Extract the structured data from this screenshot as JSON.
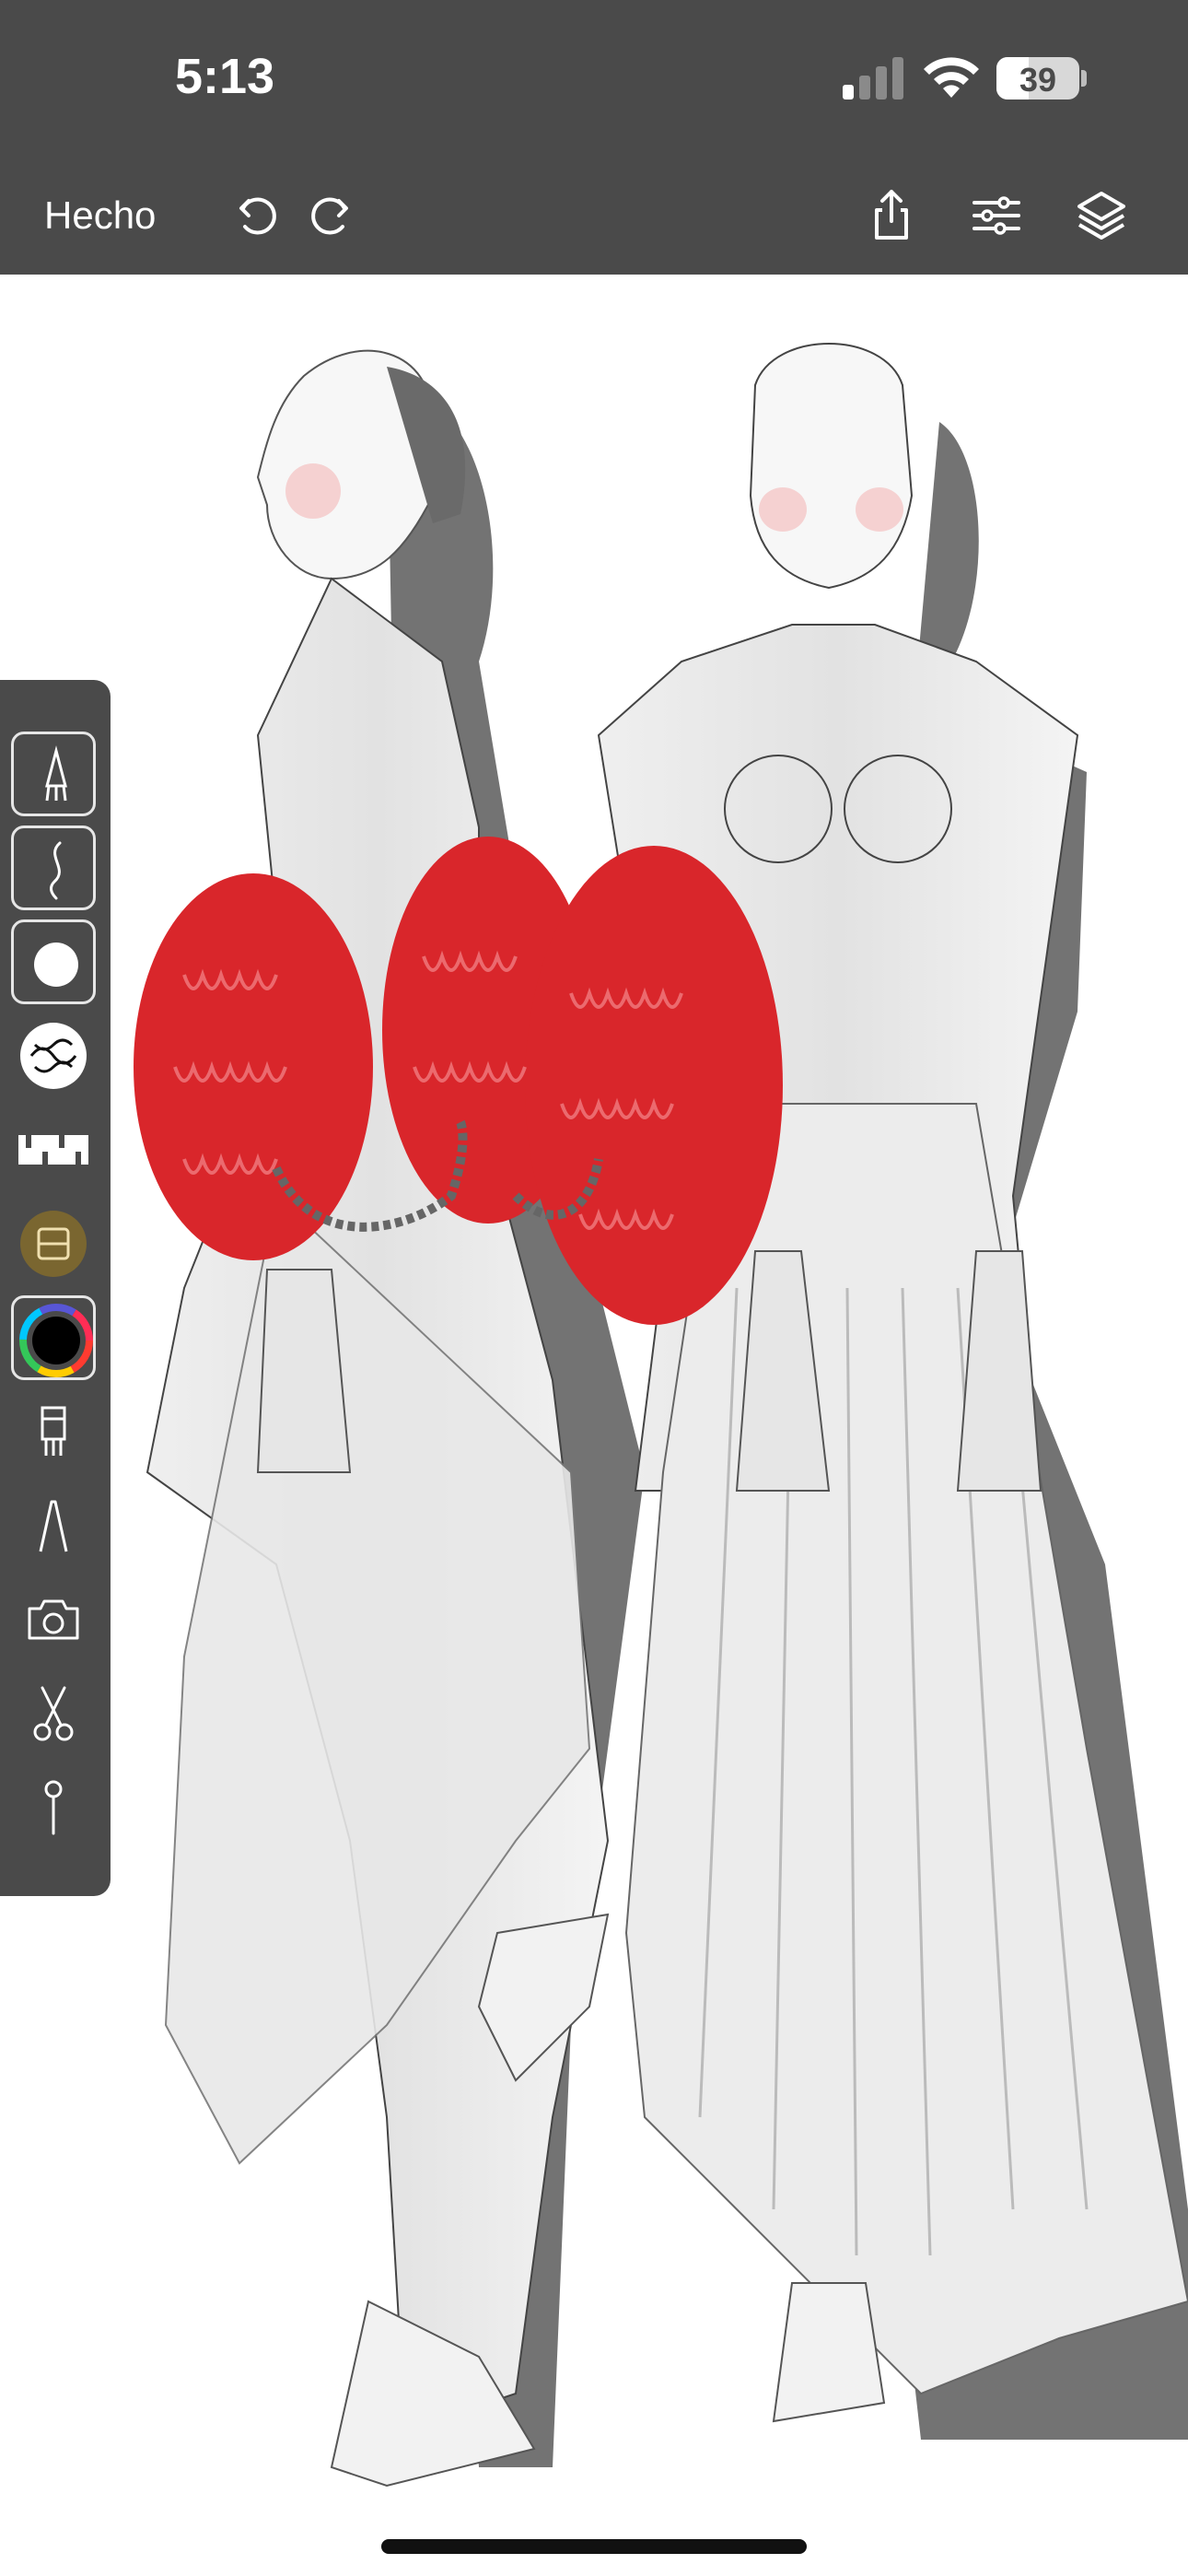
{
  "status_bar": {
    "time": "5:13",
    "battery_percent": "39",
    "battery_level": 0.39,
    "signal_bars_active": 1,
    "signal_bars_total": 4
  },
  "toolbar": {
    "done_label": "Hecho",
    "icons": [
      "undo-icon",
      "redo-icon",
      "share-icon",
      "adjustments-icon",
      "layers-icon"
    ]
  },
  "tool_palette": {
    "tools": [
      "pencil-brush-icon",
      "smudge-stroke-icon",
      "round-brush-icon",
      "pattern-stamp-icon",
      "pattern-strip-icon",
      "texture-fill-icon",
      "color-wheel-icon",
      "ruler-comb-icon",
      "pen-nib-icon",
      "camera-icon",
      "scissors-icon",
      "pin-icon"
    ],
    "selected_color": "#000000"
  },
  "canvas": {
    "accent_color": "#d9262b",
    "background": "#ffffff"
  }
}
